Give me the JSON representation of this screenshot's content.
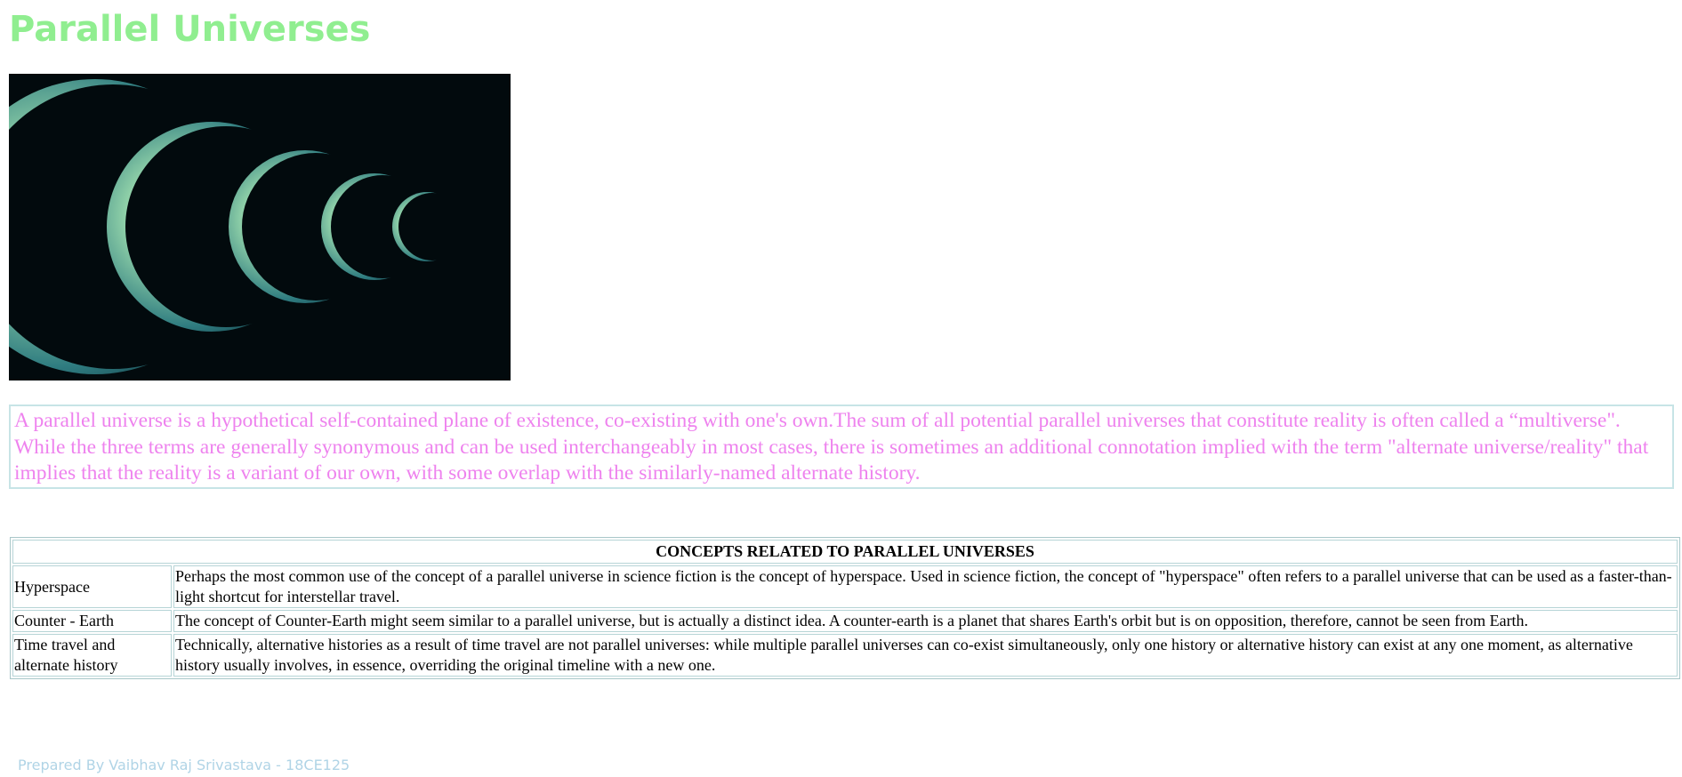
{
  "page": {
    "title": "Parallel Universes",
    "title_color": "#90ee90"
  },
  "hero_image": {
    "description_name": "parallel-earths-image",
    "background_color": "#020a0d"
  },
  "intro": {
    "text": "A parallel universe is a hypothetical self-contained plane of existence, co-existing with one's own.The sum of all potential parallel universes that constitute reality is often called a “multiverse\". While the three terms are generally synonymous and can be used interchangeably in most cases, there is sometimes an additional connotation implied with the term \"alternate universe/reality\" that implies that the reality is a variant of our own, with some overlap with the similarly-named alternate history.",
    "text_color": "#ee82ee"
  },
  "concepts_table": {
    "heading": "CONCEPTS RELATED TO PARALLEL UNIVERSES",
    "rows": [
      {
        "term": "Hyperspace",
        "description": "Perhaps the most common use of the concept of a parallel universe in science fiction is the concept of hyperspace. Used in science fiction, the concept of \"hyperspace\" often refers to a parallel universe that can be used as a faster-than-light shortcut for interstellar travel."
      },
      {
        "term": "Counter - Earth",
        "description": "The concept of Counter-Earth might seem similar to a parallel universe, but is actually a distinct idea. A counter-earth is a planet that shares Earth's orbit but is on opposition, therefore, cannot be seen from Earth."
      },
      {
        "term": "Time travel and alternate history",
        "description": "Technically, alternative histories as a result of time travel are not parallel universes: while multiple parallel universes can co-exist simultaneously, only one history or alternative history can exist at any one moment, as alternative history usually involves, in essence, overriding the original timeline with a new one."
      }
    ]
  },
  "footer": {
    "text": "Prepared By Vaibhav Raj Srivastava - 18CE125",
    "text_color": "#b0d4e6"
  }
}
